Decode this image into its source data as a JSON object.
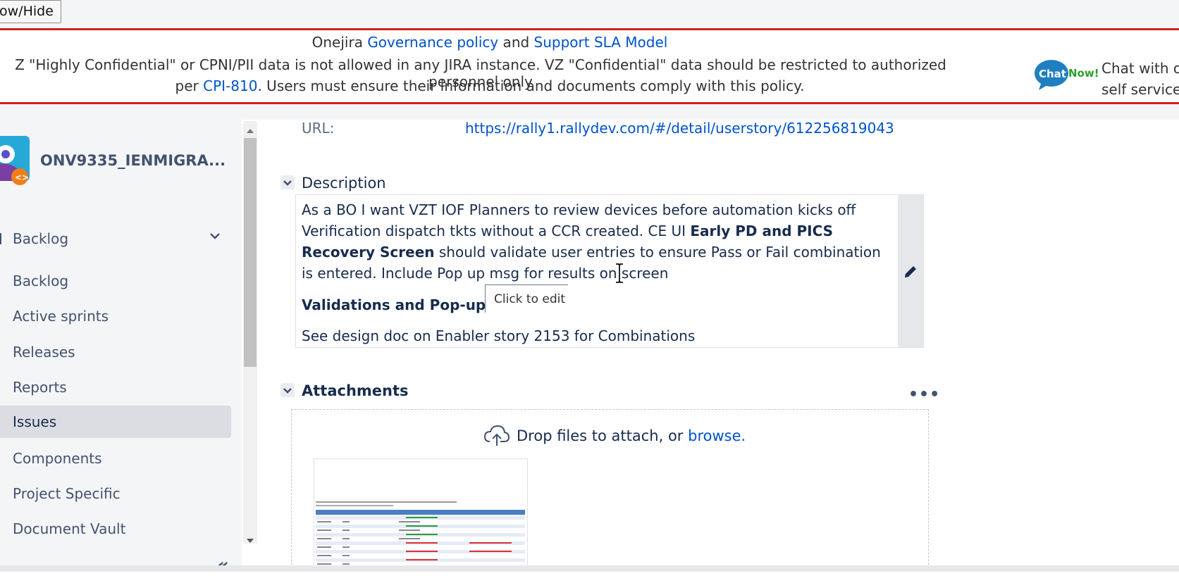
{
  "topbar": {
    "show_hide_label": "ow/Hide"
  },
  "banner": {
    "line1_prefix": "Onejira ",
    "governance_link": "Governance policy",
    "line1_and": " and ",
    "sla_link": "Support SLA Model",
    "line2": "Z \"Highly Confidential\" or CPNI/PII data is not allowed in any JIRA instance. VZ \"Confidential\" data should be restricted to authorized personnel only",
    "line3_prefix": "per ",
    "cpi_link": "CPI-810",
    "line3_suffix": ". Users must ensure their information and documents comply with this policy.",
    "chat_logo_text_1": "Chat",
    "chat_logo_text_2": "Now!",
    "chat_line1": "Chat with ou",
    "chat_line2": "self service o"
  },
  "sidebar": {
    "project_name": "ONV9335_IENMIGRA...",
    "group_label": "Backlog",
    "items": [
      {
        "label": "Backlog"
      },
      {
        "label": "Active sprints"
      },
      {
        "label": "Releases"
      },
      {
        "label": "Reports"
      },
      {
        "label": "Issues"
      },
      {
        "label": "Components"
      },
      {
        "label": "Project Specific"
      },
      {
        "label": "Document Vault"
      }
    ],
    "active_item": "Issues",
    "collapse_glyph": "«"
  },
  "main": {
    "url_label": "URL:",
    "url_value": "https://rally1.rallydev.com/#/detail/userstory/612256819043",
    "description": {
      "title": "Description",
      "para1_a": "As a BO I want VZT IOF Planners to review devices before automation kicks off Verification dispatch tkts without a CCR created. CE UI ",
      "para1_bold": "Early PD and PICS Recovery Screen",
      "para1_b": " should validate user entries to ensure Pass or Fail combination is entered. Include Pop up msg for results on screen",
      "heading": "Validations and Pop-up me",
      "para2": "See design doc on Enabler story 2153 for Combinations",
      "tooltip": "Click to edit"
    },
    "attachments": {
      "title": "Attachments",
      "more": "•••",
      "drop_text": "Drop files to attach, or ",
      "browse_link": "browse."
    }
  },
  "colors": {
    "banner_border": "#d42020",
    "link": "#0052cc",
    "sidebar_bg": "#f4f5f7",
    "active_item_bg": "#dcdde3"
  }
}
